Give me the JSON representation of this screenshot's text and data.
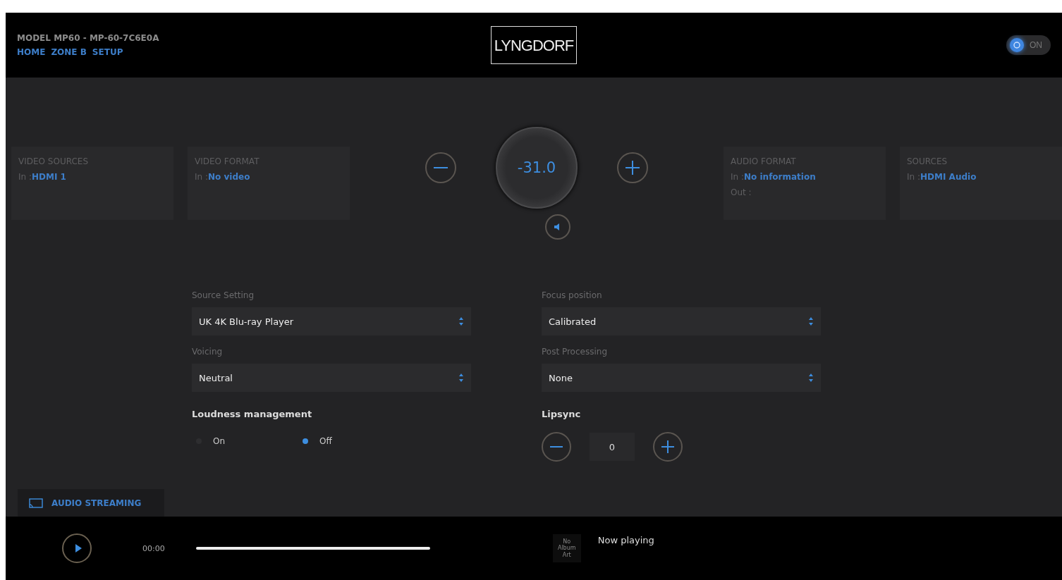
{
  "header": {
    "model": "MODEL MP60 - MP-60-7C6E0A",
    "nav": [
      {
        "label": "HOME"
      },
      {
        "label": "ZONE B"
      },
      {
        "label": "SETUP"
      }
    ],
    "logo": "LYNGDORF",
    "power": {
      "label": "ON",
      "on": true
    }
  },
  "info_cards_left": [
    {
      "title": "VIDEO SOURCES",
      "lines": [
        {
          "prefix": "In :",
          "value": "HDMI 1"
        }
      ]
    },
    {
      "title": "VIDEO FORMAT",
      "lines": [
        {
          "prefix": "In :",
          "value": "No video"
        }
      ]
    }
  ],
  "volume": {
    "value": "-31.0"
  },
  "info_cards_right": [
    {
      "title": "AUDIO FORMAT",
      "lines": [
        {
          "prefix": "In :",
          "value": "No information"
        },
        {
          "prefix": "Out :"
        }
      ]
    },
    {
      "title": "SOURCES",
      "lines": [
        {
          "prefix": "In :",
          "value": "HDMI Audio"
        }
      ]
    }
  ],
  "settings_left": [
    {
      "label": "Source Setting",
      "value": "UK 4K Blu-ray Player"
    },
    {
      "label": "Voicing",
      "value": "Neutral"
    }
  ],
  "settings_right": [
    {
      "label": "Focus position",
      "value": "Calibrated"
    },
    {
      "label": "Post Processing",
      "value": "None"
    }
  ],
  "loudness": {
    "title": "Loudness management",
    "options": [
      {
        "label": "On",
        "selected": false
      },
      {
        "label": "Off",
        "selected": true
      }
    ]
  },
  "lipsync": {
    "title": "Lipsync",
    "value": "0"
  },
  "streaming_tab": {
    "label": "AUDIO STREAMING"
  },
  "player": {
    "time": "00:00",
    "album_art": "No Album Art",
    "status": "Now playing"
  }
}
